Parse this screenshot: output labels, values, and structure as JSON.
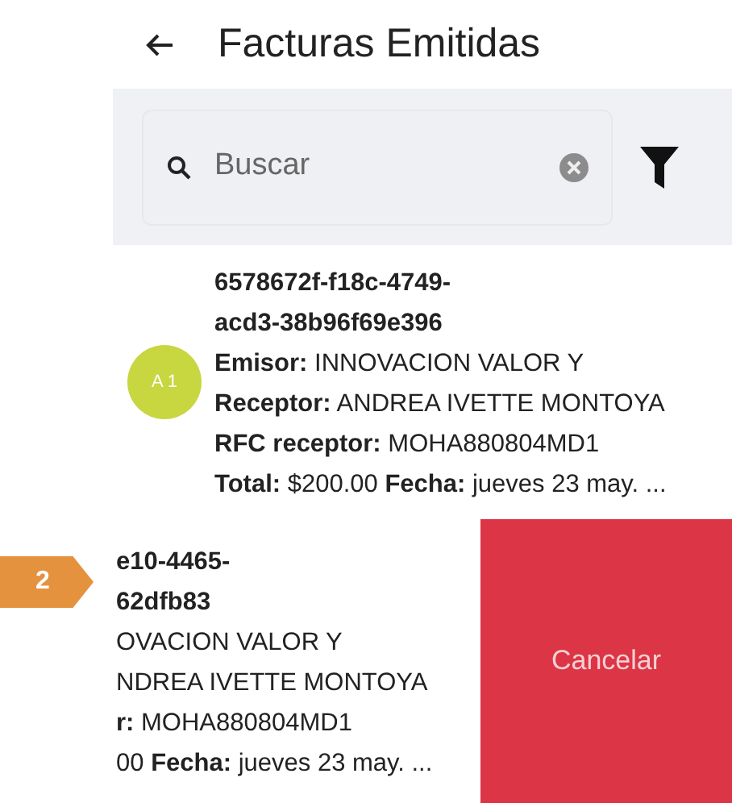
{
  "header": {
    "title": "Facturas Emitidas"
  },
  "search": {
    "placeholder": "Buscar"
  },
  "items": [
    {
      "swiped": false,
      "avatar": {
        "label": "A 1",
        "color": "#c8d640"
      },
      "id_lines": [
        "6578672f-f18c-4749-",
        "acd3-38b96f69e396"
      ],
      "lines": [
        "**Emisor:** INNOVACION VALOR Y",
        "**Receptor:** ANDREA IVETTE MONTOYA",
        "**RFC receptor:** MOHA880804MD1",
        "**Total:** $200.00  **Fecha:** jueves 23 may. ..."
      ]
    },
    {
      "swiped": true,
      "action": {
        "label": "Cancelar"
      },
      "id_lines": [
        "e10-4465-",
        "62dfb83"
      ],
      "lines": [
        "OVACION VALOR Y",
        "NDREA IVETTE MONTOYA",
        "**r:** MOHA880804MD1",
        "00  **Fecha:** jueves 23 may. ..."
      ]
    }
  ],
  "callout": {
    "label": "2"
  }
}
